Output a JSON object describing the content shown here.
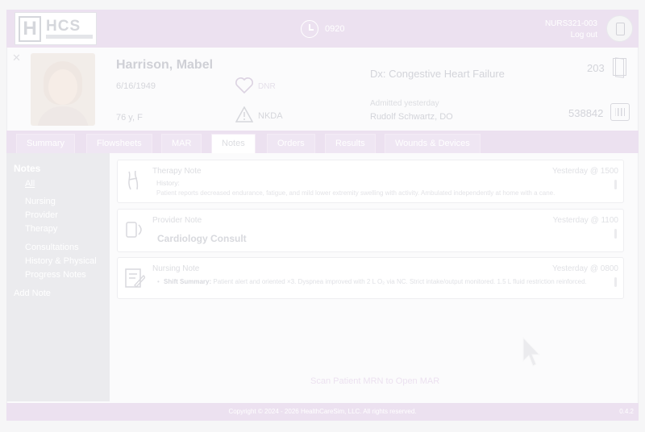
{
  "header": {
    "logo_text": "HCS",
    "logo_mark": "H",
    "clock_time": "0920",
    "user_id": "NURS321-003",
    "logout_label": "Log out"
  },
  "patient": {
    "name": "Harrison, Mabel",
    "dob": "6/16/1949",
    "age_sex": "76 y, F",
    "code_status": "DNR",
    "allergies": "NKDA",
    "diagnosis": "Dx: Congestive Heart Failure",
    "admitted": "Admitted yesterday",
    "physician": "Rudolf Schwartz, DO",
    "room": "203",
    "mrn": "538842"
  },
  "tabs": [
    {
      "label": "Summary"
    },
    {
      "label": "Flowsheets"
    },
    {
      "label": "MAR"
    },
    {
      "label": "Notes"
    },
    {
      "label": "Orders"
    },
    {
      "label": "Results"
    },
    {
      "label": "Wounds & Devices"
    }
  ],
  "active_tab": "Notes",
  "sidebar": {
    "title": "Notes",
    "items": [
      {
        "label": "All"
      },
      {
        "label": "Nursing"
      },
      {
        "label": "Provider"
      },
      {
        "label": "Therapy"
      },
      {
        "label": "Consultations"
      },
      {
        "label": "History & Physical"
      },
      {
        "label": "Progress Notes"
      }
    ],
    "add_note_label": "Add Note"
  },
  "notes": [
    {
      "type": "Therapy Note",
      "time": "Yesterday @ 1500",
      "label": "History:",
      "text": "Patient reports decreased endurance, fatigue, and mild lower extremity swelling with activity. Ambulated independently at home with a cane."
    },
    {
      "type": "Provider Note",
      "time": "Yesterday @ 1100",
      "title": "Cardiology Consult"
    },
    {
      "type": "Nursing Note",
      "time": "Yesterday @ 0800",
      "bullet_label": "Shift Summary:",
      "bullet_text": "Patient alert and oriented ×3. Dyspnea improved with 2 L O₂ via NC. Strict intake/output monitored. 1.5 L fluid restriction reinforced."
    }
  ],
  "scan_hint": "Scan Patient MRN to Open MAR",
  "footer": {
    "copyright": "Copyright © 2024 - 2026 HealthCareSim, LLC. All rights reserved.",
    "version": "0.4.2"
  },
  "colors": {
    "accent": "#ece1f0",
    "nav_bg": "#ebebee",
    "card_border": "#eeeef1"
  },
  "icons": [
    "clock-icon",
    "user-avatar-icon",
    "heart-icon",
    "warning-icon",
    "door-icon",
    "barcode-icon",
    "therapy-note-icon",
    "provider-note-icon",
    "nursing-note-icon",
    "mouse-cursor"
  ]
}
